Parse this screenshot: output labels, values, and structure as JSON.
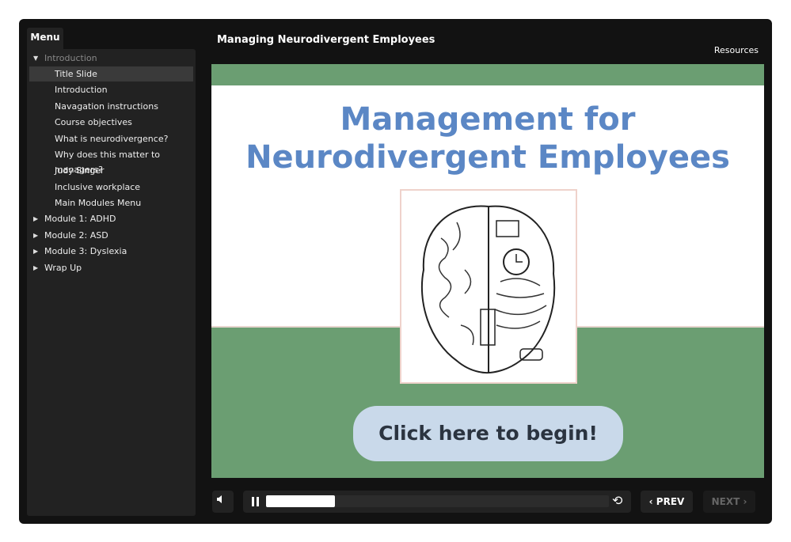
{
  "menu": {
    "tab_label": "Menu",
    "sections": [
      {
        "label": "Introduction",
        "expanded": true,
        "items": [
          "Title Slide",
          "Introduction",
          "Navagation instructions",
          "Course objectives",
          "What is neurodivergence?",
          "Why does this matter to managers?",
          "Judy Singer",
          "Inclusive workplace",
          "Main Modules Menu"
        ]
      },
      {
        "label": "Module 1: ADHD"
      },
      {
        "label": "Module 2: ASD"
      },
      {
        "label": "Module 3: Dyslexia"
      },
      {
        "label": "Wrap Up"
      }
    ],
    "selected": "Title Slide"
  },
  "header": {
    "title": "Managing Neurodivergent Employees",
    "resources": "Resources"
  },
  "slide": {
    "title_line1": "Management for",
    "title_line2": "Neurodivergent Employees",
    "begin_button": "Click here to begin!"
  },
  "controls": {
    "progress_percent": 20,
    "prev": "PREV",
    "next": "NEXT"
  },
  "colors": {
    "green": "#6b9e72",
    "title_blue": "#5b87c5",
    "button": "#c9d9ea"
  }
}
